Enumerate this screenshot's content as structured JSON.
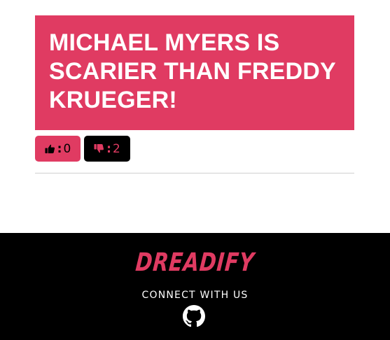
{
  "opinion": {
    "text": "MICHAEL MYERS IS SCARIER THAN FREDDY KRUEGER!"
  },
  "votes": {
    "up": {
      "icon": "thumbs-up-icon",
      "separator": ":",
      "count": "0"
    },
    "down": {
      "icon": "thumbs-down-icon",
      "separator": ":",
      "count": "2"
    }
  },
  "footer": {
    "brand": "DREADIFY",
    "connect": "CONNECT WITH US",
    "social_icon": "github-icon"
  },
  "colors": {
    "accent": "#e03b62",
    "footer_bg": "#000000",
    "text_light": "#ffffff"
  }
}
